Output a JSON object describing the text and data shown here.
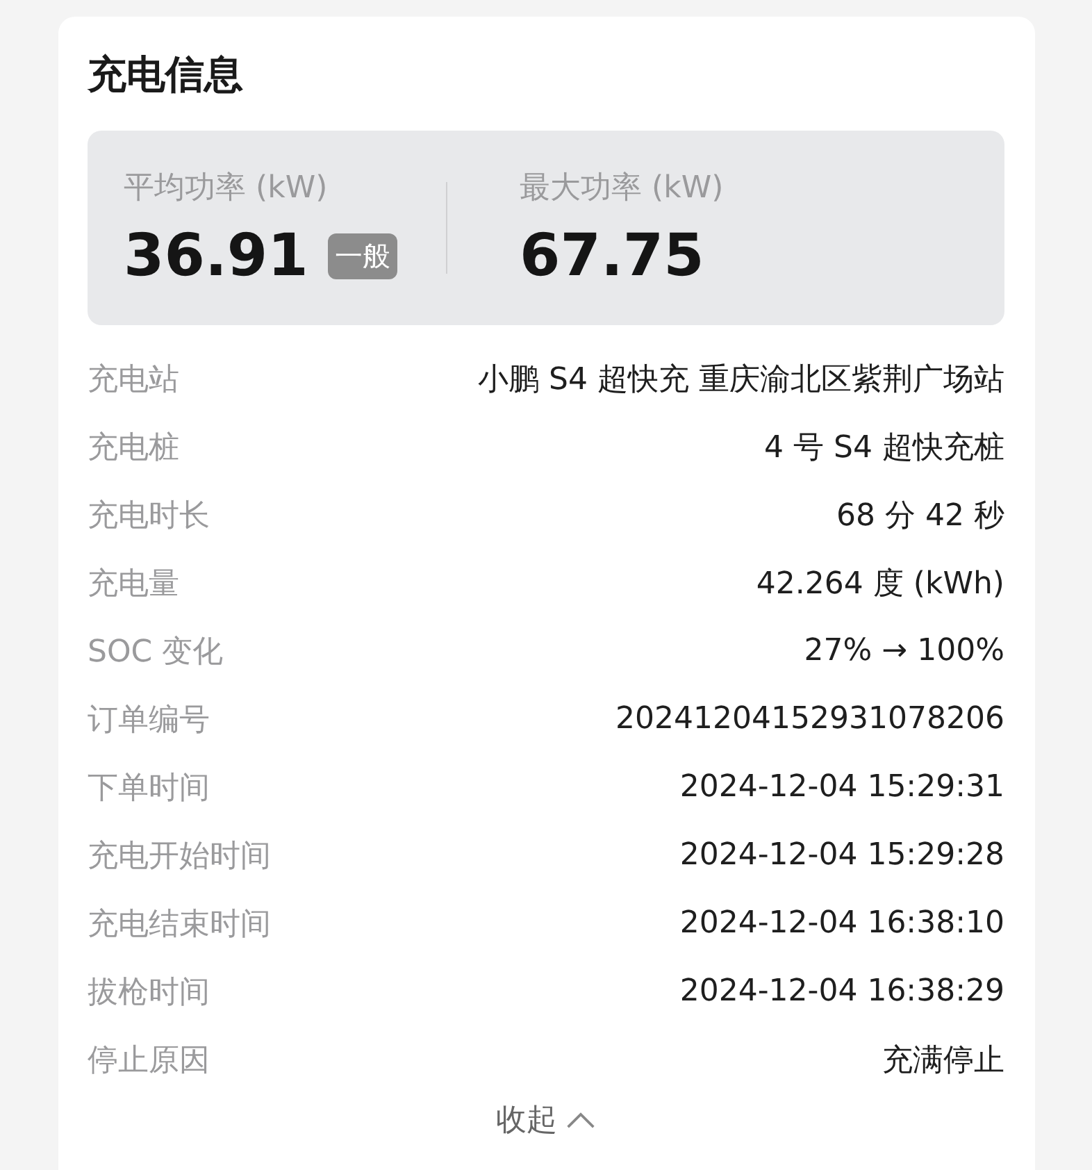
{
  "title": "充电信息",
  "stats": [
    {
      "label": "平均功率 (kW)",
      "value": "36.91",
      "badge": "一般"
    },
    {
      "label": "最大功率 (kW)",
      "value": "67.75"
    }
  ],
  "rows": [
    {
      "label": "充电站",
      "value": "小鹏 S4 超快充 重庆渝北区紫荆广场站"
    },
    {
      "label": "充电桩",
      "value": "4 号 S4 超快充桩"
    },
    {
      "label": "充电时长",
      "value": "68 分 42 秒"
    },
    {
      "label": "充电量",
      "value": "42.264 度 (kWh)"
    },
    {
      "label": "SOC 变化",
      "value": "27% → 100%"
    },
    {
      "label": "订单编号",
      "value": "20241204152931078206"
    },
    {
      "label": "下单时间",
      "value": "2024-12-04 15:29:31"
    },
    {
      "label": "充电开始时间",
      "value": "2024-12-04 15:29:28"
    },
    {
      "label": "充电结束时间",
      "value": "2024-12-04 16:38:10"
    },
    {
      "label": "拔枪时间",
      "value": "2024-12-04 16:38:29"
    },
    {
      "label": "停止原因",
      "value": "充满停止"
    }
  ],
  "collapse": {
    "label": "收起"
  }
}
